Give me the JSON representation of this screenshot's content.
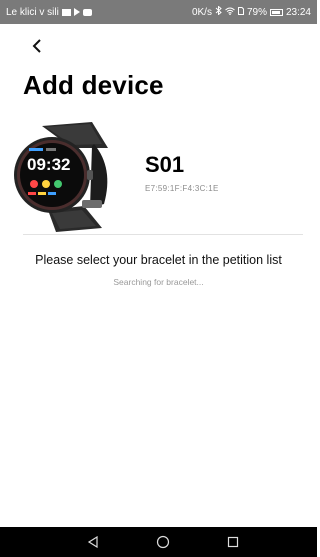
{
  "status_bar": {
    "carrier": "Le klici v sili",
    "network_speed": "0K/s",
    "battery_percent": "79%",
    "time": "23:24"
  },
  "header": {
    "back_icon": "chevron-left-icon",
    "title": "Add device"
  },
  "device": {
    "image": "smartwatch-image",
    "watch_time": "09:32",
    "name": "S01",
    "mac": "E7:59:1F:F4:3C:1E"
  },
  "instruction": "Please select your bracelet in the petition list",
  "searching": "Searching for bracelet...",
  "nav_bar": {
    "back_icon": "triangle-back-icon",
    "home_icon": "circle-home-icon",
    "recents_icon": "square-recents-icon"
  },
  "colors": {
    "status_bar_bg": "#7a7a7a",
    "nav_bar_bg": "#000000",
    "muted_text": "#999999"
  }
}
